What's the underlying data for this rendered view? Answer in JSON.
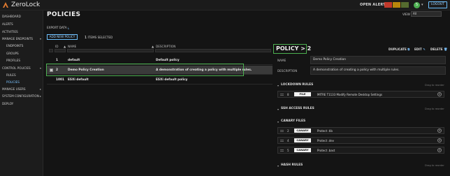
{
  "app": {
    "brand": "ZeroLock"
  },
  "topbar": {
    "open_alerts_label": "OPEN ALERTS",
    "alert_boxes": [
      "#c0392b",
      "#b8860b",
      "#556b2f",
      "#556b2f"
    ],
    "user_initial": "S",
    "logout_label": "LOGOUT"
  },
  "sidebar": {
    "items": [
      {
        "label": "DASHBOARD"
      },
      {
        "label": "ALERTS"
      },
      {
        "label": "ACTIVITIES"
      },
      {
        "label": "MANAGE ENDPOINTS"
      },
      {
        "label": "ENDPOINTS"
      },
      {
        "label": "GROUPS"
      },
      {
        "label": "PROFILES"
      },
      {
        "label": "CONTROL POLICIES"
      },
      {
        "label": "RULES"
      },
      {
        "label": "POLICIES"
      },
      {
        "label": "MANAGE USERS"
      },
      {
        "label": "SYSTEM CONFIGURATION"
      },
      {
        "label": "DEPLOY"
      }
    ]
  },
  "main": {
    "title": "POLICIES",
    "export_label": "EXPORT DATA",
    "add_policy_label": "ADD NEW POLICY",
    "selected_count": "1",
    "selected_label": "ITEMS SELECTED",
    "view_label": "VIEW",
    "view_value": "All",
    "columns": {
      "id": "ID",
      "name": "NAME",
      "description": "DESCRIPTION"
    },
    "rows": [
      {
        "id": "1",
        "name": "default",
        "description": "Default policy"
      },
      {
        "id": "2",
        "name": "Demo Policy Creation",
        "description": "A demonstration of creating a policy with multiple rules."
      },
      {
        "id": "1001",
        "name": "ESXi default",
        "description": "ESXi default policy"
      }
    ]
  },
  "detail": {
    "title": "POLICY > 2",
    "duplicate_label": "DUPLICATE",
    "edit_label": "EDIT",
    "delete_label": "DELETE",
    "name_label": "NAME",
    "name_value": "Demo Policy Creation",
    "description_label": "DESCRIPTION",
    "description_value": "A demonstration of creating a policy with multiple rules.",
    "drag_hint": "Drag to reorder",
    "sections": {
      "lockdown": "LOCKDOWN RULES",
      "ssh": "SSH ACCESS RULES",
      "canary": "CANARY FILES",
      "hash": "HASH RULES"
    },
    "lockdown_rules": [
      {
        "num": "8",
        "tag": "FILE",
        "text": "MITRE T1133 Modify Remote Desktop Settings"
      }
    ],
    "canary_files": [
      {
        "num": "2",
        "tag": "CANARY",
        "text": "Protect .tib"
      },
      {
        "num": "4",
        "tag": "CANARY",
        "text": "Protect .dev"
      },
      {
        "num": "5",
        "tag": "CANARY",
        "text": "Protect .bast"
      }
    ]
  }
}
